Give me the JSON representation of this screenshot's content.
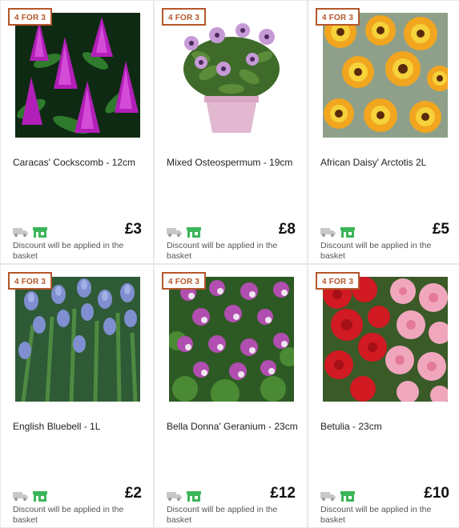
{
  "products": [
    {
      "badge": "4 FOR 3",
      "name": "Caracas' Cockscomb - 12cm",
      "price": "£3",
      "discount_note": "Discount will be applied in the basket",
      "image": "magenta-cockscomb-flowers",
      "delivery_icon": "delivery-truck-icon",
      "collect_icon": "store-collect-icon"
    },
    {
      "badge": "4 FOR 3",
      "name": "Mixed Osteospermum - 19cm",
      "price": "£8",
      "discount_note": "Discount will be applied in the basket",
      "image": "lilac-osteospermum-pot",
      "delivery_icon": "delivery-truck-icon",
      "collect_icon": "store-collect-icon"
    },
    {
      "badge": "4 FOR 3",
      "name": "African Daisy' Arctotis 2L",
      "price": "£5",
      "discount_note": "Discount will be applied in the basket",
      "image": "orange-yellow-daisies",
      "delivery_icon": "delivery-truck-icon",
      "collect_icon": "store-collect-icon"
    },
    {
      "badge": "4 FOR 3",
      "name": "English Bluebell - 1L",
      "price": "£2",
      "discount_note": "Discount will be applied in the basket",
      "image": "blue-bluebells",
      "delivery_icon": "delivery-truck-icon",
      "collect_icon": "store-collect-icon"
    },
    {
      "badge": "4 FOR 3",
      "name": "Bella Donna' Geranium - 23cm",
      "price": "£12",
      "discount_note": "Discount will be applied in the basket",
      "image": "purple-white-geraniums",
      "delivery_icon": "delivery-truck-icon",
      "collect_icon": "store-collect-icon"
    },
    {
      "badge": "4 FOR 3",
      "name": "Betulia - 23cm",
      "price": "£10",
      "discount_note": "Discount will be applied in the basket",
      "image": "red-pink-begonias",
      "delivery_icon": "delivery-truck-icon",
      "collect_icon": "store-collect-icon"
    }
  ],
  "colors": {
    "badge": "#b5562a",
    "collect_icon": "#3cb55a",
    "delivery_icon": "#c8c8c8"
  }
}
